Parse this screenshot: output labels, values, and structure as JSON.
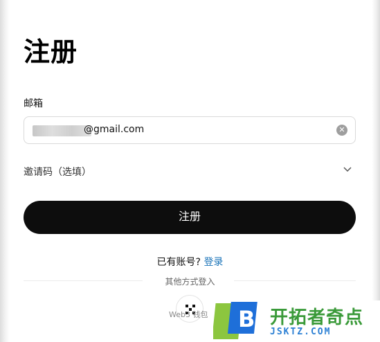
{
  "page": {
    "title": "注册"
  },
  "email": {
    "label": "邮箱",
    "value_suffix": "@gmail.com"
  },
  "invite": {
    "label": "邀请码（选填）"
  },
  "submit": {
    "label": "注册"
  },
  "footer": {
    "have_account": "已有账号?",
    "login_link": "登录",
    "other_methods": "其他方式登入",
    "web3_label": "Web3 钱包"
  },
  "watermark": {
    "brand": "开拓者奇点",
    "url": "JSKTZ.COM",
    "logo_letter": "B"
  },
  "colors": {
    "button_bg": "#0d0d0d",
    "link": "#1a73b8",
    "watermark_green": "#3a9a39",
    "watermark_blue": "#2a7fd4"
  }
}
